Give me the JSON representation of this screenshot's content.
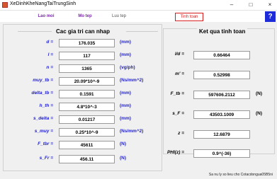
{
  "window": {
    "title": "XeDinhKheNangTaiTrungSinh",
    "minimize": "–",
    "maximize": "□",
    "close": "×"
  },
  "toolbar": {
    "new_label": "Lao moi",
    "open_label": "Mo tep",
    "save_label": "Luu tep",
    "calc_label": "Tinh toan",
    "help_label": "?"
  },
  "inputs": {
    "title": "Cac gia tri can nhap",
    "rows": [
      {
        "label": "d =",
        "value": "176.035",
        "unit": "(mm)"
      },
      {
        "label": "l =",
        "value": "117",
        "unit": "(mm)"
      },
      {
        "label": "n =",
        "value": "1365",
        "unit": "(vg/ph)"
      },
      {
        "label": "muy_tb =",
        "value": "20.09*10^-9",
        "unit": "(Ns/mm^2)"
      },
      {
        "label": "delta_tb =",
        "value": "0.1591",
        "unit": "(mm)"
      },
      {
        "label": "h_th =",
        "value": "4.8*10^-3",
        "unit": "(mm)"
      },
      {
        "label": "s_delta =",
        "value": "0.01217",
        "unit": "(mm)"
      },
      {
        "label": "s_muy =",
        "value": "0.25*10^-9",
        "unit": "(Ns/mm^2)"
      },
      {
        "label": "F_tbr =",
        "value": "45611",
        "unit": "(N)"
      },
      {
        "label": "s_Fr =",
        "value": "456.11",
        "unit": "(N)"
      }
    ]
  },
  "results": {
    "title": "Ket qua tinh toan",
    "rows": [
      {
        "label": "l/d =",
        "value": "0.66464",
        "unit": ""
      },
      {
        "label": "m' =",
        "value": "0.52998",
        "unit": ""
      },
      {
        "label": "F_tb =",
        "value": "597606.2112",
        "unit": "(N)"
      },
      {
        "label": "s_F =",
        "value": "43503.1009",
        "unit": "(N)"
      },
      {
        "label": "z =",
        "value": "12.6879",
        "unit": ""
      },
      {
        "label": "PHI(z) =",
        "value": "0.9^(-36)",
        "unit": ""
      }
    ]
  },
  "status": "Sa nu ly so lieu cho  Cotacdongua05B5ni"
}
